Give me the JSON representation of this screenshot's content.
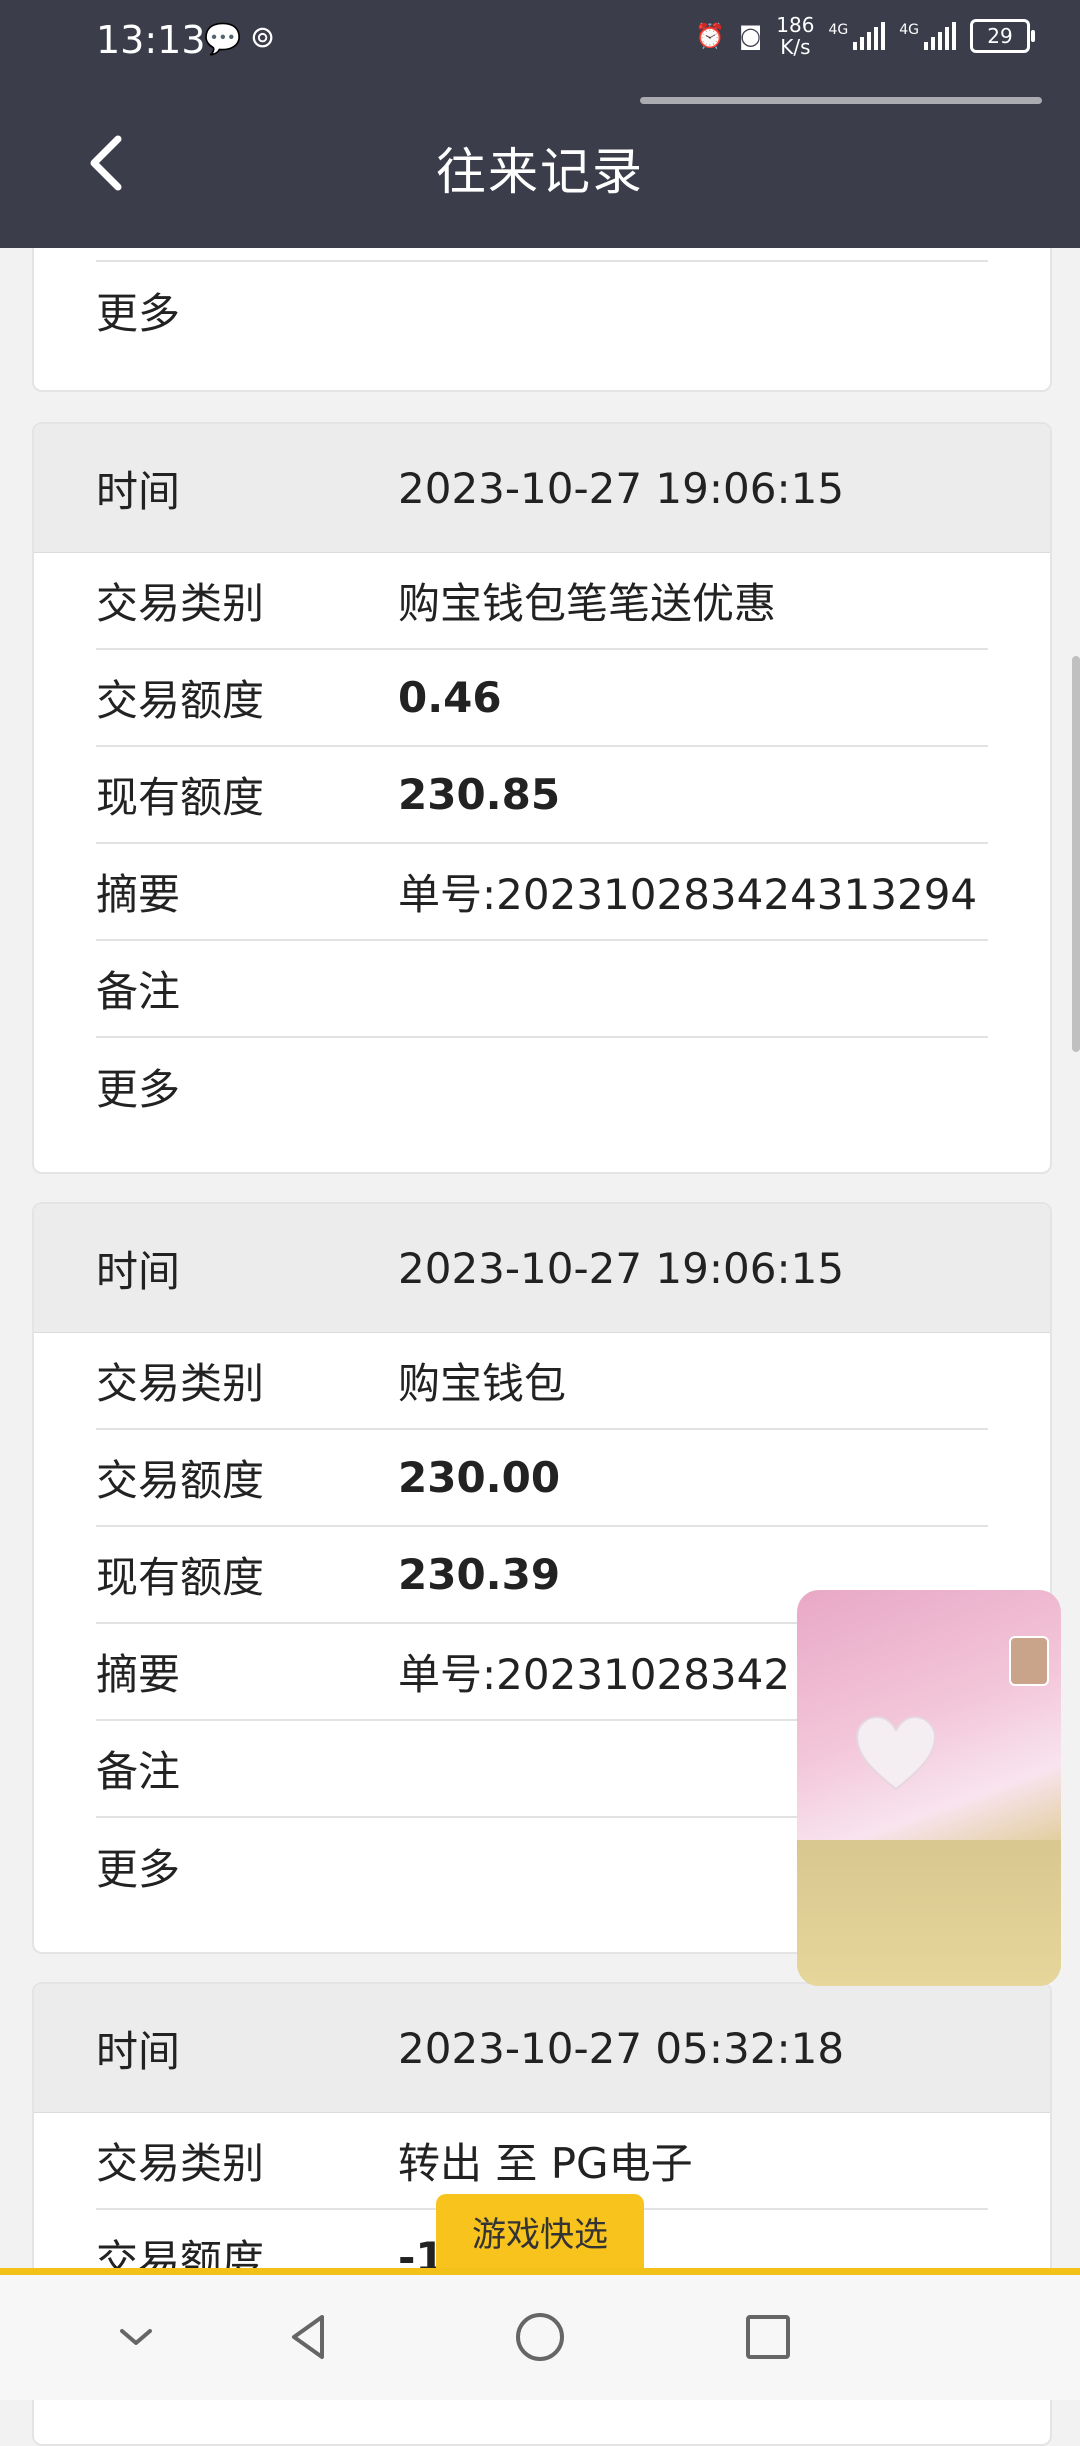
{
  "status_bar": {
    "time": "13:13",
    "net_speed_value": "186",
    "net_speed_unit": "K/s",
    "signal1_label": "4G",
    "signal2_label": "4G",
    "battery": "29"
  },
  "header": {
    "title": "往来记录"
  },
  "labels": {
    "time": "时间",
    "type": "交易类别",
    "amount": "交易额度",
    "balance": "现有额度",
    "summary": "摘要",
    "remark": "备注",
    "more": "更多"
  },
  "records": [
    {
      "time": "2023-10-27 19:06:15",
      "type": "购宝钱包笔笔送优惠",
      "amount": "0.46",
      "balance": "230.85",
      "summary": "单号:202310283424313294",
      "remark": ""
    },
    {
      "time": "2023-10-27 19:06:15",
      "type": "购宝钱包",
      "amount": "230.00",
      "balance": "230.39",
      "summary": "单号:20231028342",
      "remark": ""
    },
    {
      "time": "2023-10-27 05:32:18",
      "type": "转出 至 PG电子",
      "amount": "-1"
    }
  ],
  "floating_button": {
    "label": "游戏快选"
  },
  "icons": {
    "back": "chevron-left-icon",
    "nav_down": "chevron-down-icon",
    "nav_back": "triangle-back-icon",
    "nav_home": "circle-home-icon",
    "nav_recent": "square-recent-icon"
  }
}
